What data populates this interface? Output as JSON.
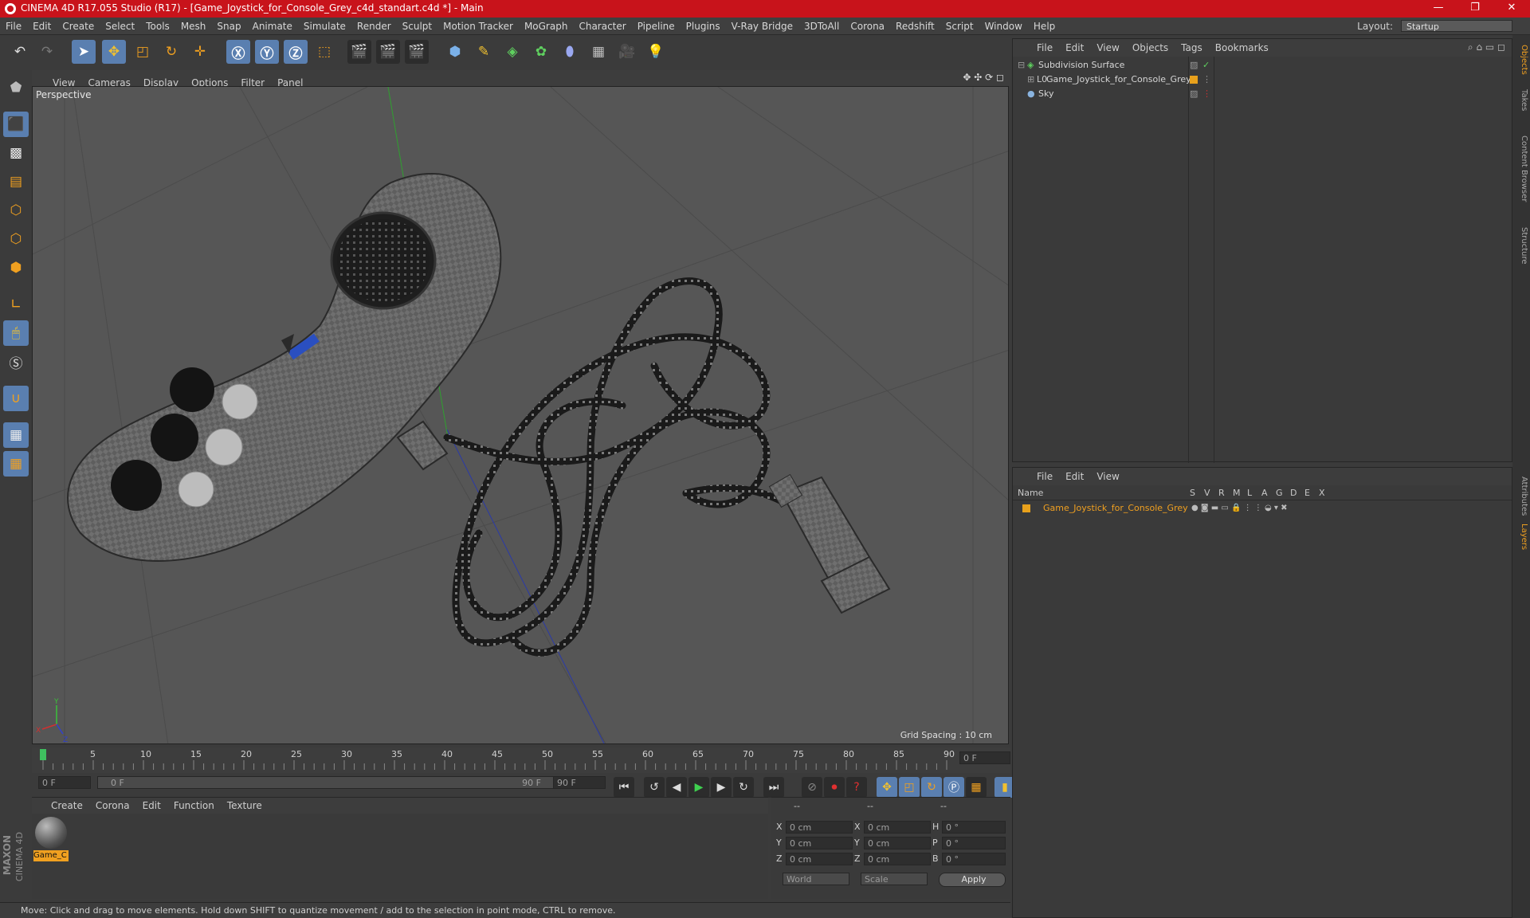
{
  "window": {
    "title": "CINEMA 4D R17.055 Studio (R17) - [Game_Joystick_for_Console_Grey_c4d_standart.c4d *] - Main",
    "controls": [
      "—",
      "❐",
      "✕"
    ]
  },
  "menubar": {
    "items": [
      "File",
      "Edit",
      "Create",
      "Select",
      "Tools",
      "Mesh",
      "Snap",
      "Animate",
      "Simulate",
      "Render",
      "Sculpt",
      "Motion Tracker",
      "MoGraph",
      "Character",
      "Pipeline",
      "Plugins",
      "V-Ray Bridge",
      "3DToAll",
      "Corona",
      "Redshift",
      "Script",
      "Window",
      "Help"
    ],
    "layout_label": "Layout:",
    "layout_value": "Startup"
  },
  "viewport": {
    "menu": [
      "View",
      "Cameras",
      "Display",
      "Options",
      "Filter",
      "Panel"
    ],
    "camera_label": "Perspective",
    "grid_spacing": "Grid Spacing : 10 cm"
  },
  "timeline": {
    "ticks": [
      "0",
      "5",
      "10",
      "15",
      "20",
      "25",
      "30",
      "35",
      "40",
      "45",
      "50",
      "55",
      "60",
      "65",
      "70",
      "75",
      "80",
      "85",
      "90"
    ],
    "current_frame": "0 F",
    "start_field": "0 F",
    "range_start": "0 F",
    "range_end": "90 F",
    "end_field": "90 F"
  },
  "material_manager": {
    "menu": [
      "Create",
      "Corona",
      "Edit",
      "Function",
      "Texture"
    ],
    "materials": [
      {
        "name": "Game_C"
      }
    ]
  },
  "coordinates": {
    "headers": [
      "--",
      "--",
      "--"
    ],
    "rows": [
      {
        "a": "X",
        "av": "0 cm",
        "b": "X",
        "bv": "0 cm",
        "c": "H",
        "cv": "0 °"
      },
      {
        "a": "Y",
        "av": "0 cm",
        "b": "Y",
        "bv": "0 cm",
        "c": "P",
        "cv": "0 °"
      },
      {
        "a": "Z",
        "av": "0 cm",
        "b": "Z",
        "bv": "0 cm",
        "c": "B",
        "cv": "0 °"
      }
    ],
    "world": "World",
    "scale": "Scale",
    "apply": "Apply"
  },
  "status": {
    "text": "Move: Click and drag to move elements. Hold down SHIFT to quantize movement / add to the selection in point mode, CTRL to remove."
  },
  "object_manager": {
    "menu": [
      "File",
      "Edit",
      "View",
      "Objects",
      "Tags",
      "Bookmarks"
    ],
    "objects": [
      {
        "name": "Subdivision Surface"
      },
      {
        "name": "Game_Joystick_for_Console_Grey"
      },
      {
        "name": "Sky"
      }
    ]
  },
  "layer_manager": {
    "menu": [
      "File",
      "Edit",
      "View"
    ],
    "columns": [
      "Name",
      "S",
      "V",
      "R",
      "M",
      "L",
      "A",
      "G",
      "D",
      "E",
      "X"
    ],
    "layers": [
      {
        "name": "Game_Joystick_for_Console_Grey"
      }
    ]
  },
  "side_tabs": [
    "Objects",
    "Takes",
    "Content Browser",
    "Structure",
    "Attributes",
    "Layers"
  ],
  "brand": {
    "logo_line1": "MAXON",
    "logo_line2": "CINEMA 4D"
  },
  "colors": {
    "title_bar": "#c8131b",
    "active_tool": "#5a7fb0",
    "layer_color": "#e8a11c",
    "selected_text": "#f0a020"
  }
}
